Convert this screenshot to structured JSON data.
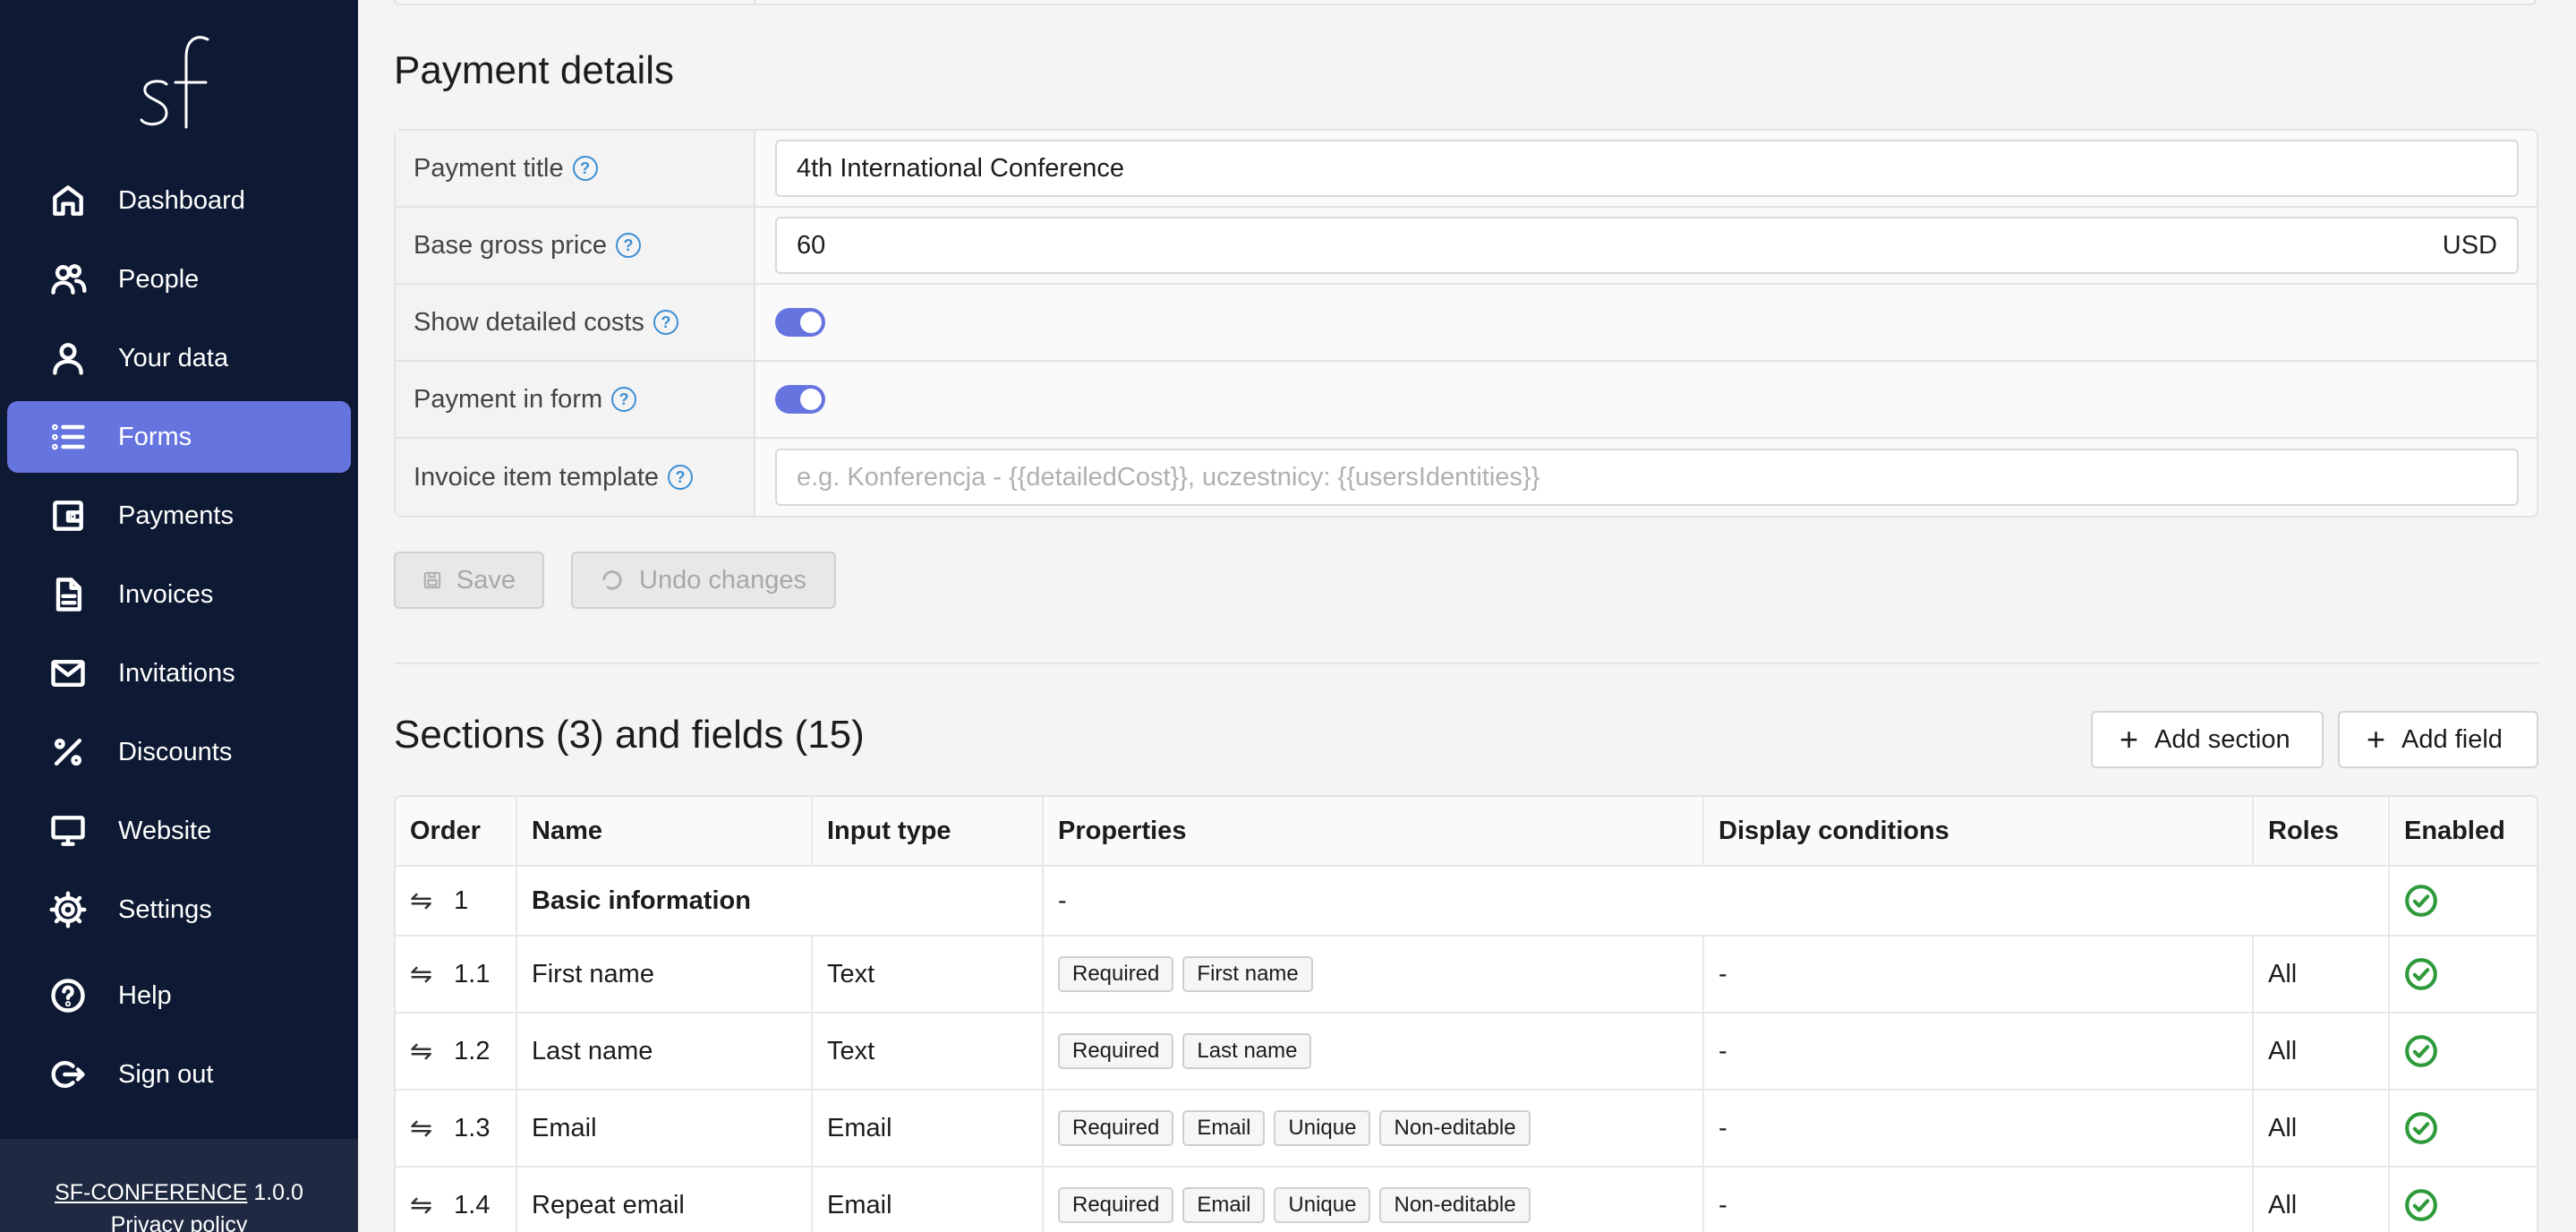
{
  "logo": "sf",
  "nav": [
    {
      "label": "Dashboard",
      "icon": "home-icon",
      "active": false
    },
    {
      "label": "People",
      "icon": "people-icon",
      "active": false
    },
    {
      "label": "Your data",
      "icon": "user-icon",
      "active": false
    },
    {
      "label": "Forms",
      "icon": "list-icon",
      "active": true
    },
    {
      "label": "Payments",
      "icon": "wallet-icon",
      "active": false
    },
    {
      "label": "Invoices",
      "icon": "document-icon",
      "active": false
    },
    {
      "label": "Invitations",
      "icon": "envelope-icon",
      "active": false
    },
    {
      "label": "Discounts",
      "icon": "percent-icon",
      "active": false
    },
    {
      "label": "Website",
      "icon": "monitor-icon",
      "active": false
    },
    {
      "label": "Settings",
      "icon": "gear-icon",
      "active": false
    }
  ],
  "nav_bottom": [
    {
      "label": "Help",
      "icon": "help-circle-icon"
    },
    {
      "label": "Sign out",
      "icon": "sign-out-icon"
    }
  ],
  "footer": {
    "app_name": "SF-CONFERENCE",
    "version": "1.0.0",
    "privacy": "Privacy policy"
  },
  "payment": {
    "title": "Payment details",
    "rows": {
      "payment_title": {
        "label": "Payment title",
        "value": "4th International Conference"
      },
      "base_price": {
        "label": "Base gross price",
        "value": "60",
        "currency": "USD"
      },
      "show_costs": {
        "label": "Show detailed costs",
        "on": true
      },
      "payment_in_form": {
        "label": "Payment in form",
        "on": true
      },
      "invoice_template": {
        "label": "Invoice item template",
        "placeholder": "e.g. Konferencja - {{detailedCost}}, uczestnicy: {{usersIdentities}}"
      }
    },
    "save_label": "Save",
    "undo_label": "Undo changes"
  },
  "sections": {
    "title": "Sections (3) and fields (15)",
    "add_section": "Add section",
    "add_field": "Add field",
    "columns": [
      "Order",
      "Name",
      "Input type",
      "Properties",
      "Display conditions",
      "Roles",
      "Enabled"
    ],
    "rows": [
      {
        "order": "1",
        "name": "Basic information",
        "section": true,
        "properties_text": "-"
      },
      {
        "order": "1.1",
        "name": "First name",
        "input": "Text",
        "tags": [
          "Required",
          "First name"
        ],
        "display": "-",
        "roles": "All"
      },
      {
        "order": "1.2",
        "name": "Last name",
        "input": "Text",
        "tags": [
          "Required",
          "Last name"
        ],
        "display": "-",
        "roles": "All"
      },
      {
        "order": "1.3",
        "name": "Email",
        "input": "Email",
        "tags": [
          "Required",
          "Email",
          "Unique",
          "Non-editable"
        ],
        "display": "-",
        "roles": "All"
      },
      {
        "order": "1.4",
        "name": "Repeat email",
        "input": "Email",
        "tags": [
          "Required",
          "Email",
          "Unique",
          "Non-editable"
        ],
        "display": "-",
        "roles": "All"
      }
    ]
  }
}
